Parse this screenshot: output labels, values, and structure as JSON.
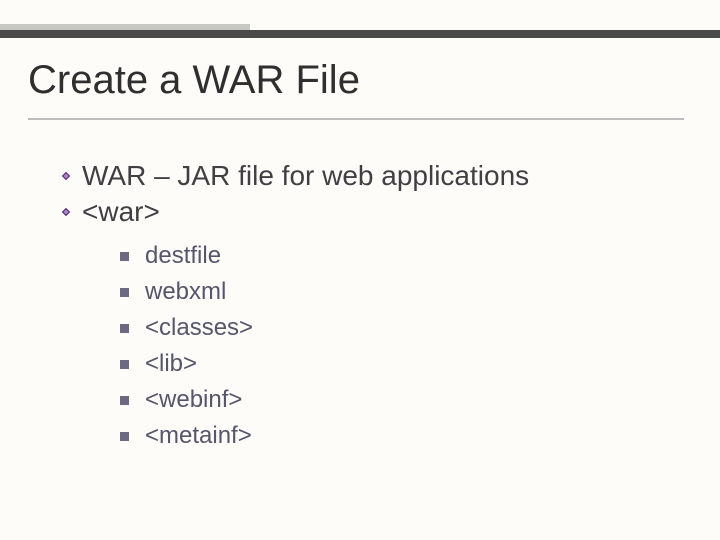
{
  "slide": {
    "title": "Create a WAR File",
    "bullets_top": [
      "WAR – JAR file for web applications",
      "<war>"
    ],
    "sub_bullets": [
      "destfile",
      "webxml",
      "<classes>",
      "<lib>",
      "<webinf>",
      "<metainf>"
    ]
  },
  "colors": {
    "accent": "#6c6a80",
    "bar_dark": "#4a4a4a",
    "bar_light": "#c6c7c1"
  }
}
